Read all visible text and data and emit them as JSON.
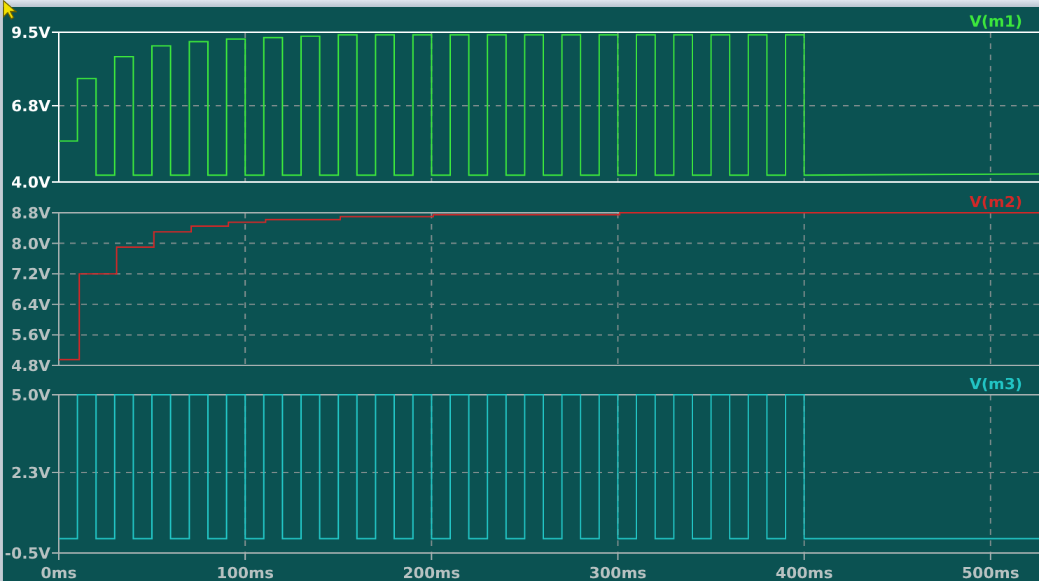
{
  "panes": [
    {
      "selected": true,
      "chart_data": {
        "type": "line",
        "grid": true,
        "xlim": [
          0,
          526
        ],
        "ylim": [
          4.0,
          9.5
        ],
        "yticks": [
          {
            "value": 4.0,
            "label": "4.0V"
          },
          {
            "value": 6.8,
            "label": "6.8V"
          },
          {
            "value": 9.5,
            "label": "9.5V"
          }
        ],
        "x": [
          0,
          10,
          10,
          20,
          20,
          30,
          30,
          40,
          40,
          50,
          50,
          60,
          60,
          70,
          70,
          80,
          80,
          90,
          90,
          100,
          100,
          110,
          110,
          120,
          120,
          130,
          130,
          140,
          140,
          150,
          150,
          160,
          160,
          170,
          170,
          180,
          180,
          190,
          190,
          200,
          200,
          210,
          210,
          220,
          220,
          230,
          230,
          240,
          240,
          250,
          250,
          260,
          260,
          270,
          270,
          280,
          280,
          290,
          290,
          300,
          300,
          310,
          310,
          320,
          320,
          330,
          330,
          340,
          340,
          350,
          350,
          360,
          360,
          370,
          370,
          380,
          380,
          390,
          390,
          400,
          400,
          526
        ],
        "series": [
          {
            "name": "V(m1)",
            "color": "#3ce63c",
            "values": [
              5.5,
              5.5,
              7.8,
              7.8,
              4.25,
              4.25,
              8.6,
              8.6,
              4.25,
              4.25,
              9.0,
              9.0,
              4.25,
              4.25,
              9.15,
              9.15,
              4.25,
              4.25,
              9.25,
              9.25,
              4.25,
              4.25,
              9.3,
              9.3,
              4.25,
              4.25,
              9.35,
              9.35,
              4.25,
              4.25,
              9.4,
              9.4,
              4.25,
              4.25,
              9.4,
              9.4,
              4.25,
              4.25,
              9.4,
              9.4,
              4.25,
              4.25,
              9.4,
              9.4,
              4.25,
              4.25,
              9.4,
              9.4,
              4.25,
              4.25,
              9.4,
              9.4,
              4.25,
              4.25,
              9.4,
              9.4,
              4.25,
              4.25,
              9.4,
              9.4,
              4.25,
              4.25,
              9.4,
              9.4,
              4.25,
              4.25,
              9.4,
              9.4,
              4.25,
              4.25,
              9.4,
              9.4,
              4.25,
              4.25,
              9.4,
              9.4,
              4.25,
              4.25,
              9.4,
              9.4,
              4.25,
              4.3
            ]
          }
        ]
      }
    },
    {
      "selected": false,
      "chart_data": {
        "type": "line",
        "grid": true,
        "xlim": [
          0,
          526
        ],
        "ylim": [
          4.8,
          8.8
        ],
        "yticks": [
          {
            "value": 4.8,
            "label": "4.8V"
          },
          {
            "value": 5.6,
            "label": "5.6V"
          },
          {
            "value": 6.4,
            "label": "6.4V"
          },
          {
            "value": 7.2,
            "label": "7.2V"
          },
          {
            "value": 8.0,
            "label": "8.0V"
          },
          {
            "value": 8.8,
            "label": "8.8V"
          }
        ],
        "x": [
          0,
          11,
          11,
          31,
          31,
          51,
          51,
          71,
          71,
          91,
          91,
          111,
          111,
          151,
          151,
          201,
          201,
          301,
          301,
          526
        ],
        "series": [
          {
            "name": "V(m2)",
            "color": "#d02828",
            "values": [
              4.95,
              4.95,
              7.2,
              7.2,
              7.9,
              7.9,
              8.3,
              8.3,
              8.45,
              8.45,
              8.55,
              8.55,
              8.62,
              8.62,
              8.7,
              8.7,
              8.75,
              8.75,
              8.8,
              8.8
            ]
          }
        ]
      }
    },
    {
      "selected": false,
      "chart_data": {
        "type": "line",
        "grid": true,
        "xlim": [
          0,
          526
        ],
        "ylim": [
          -0.5,
          5.0
        ],
        "yticks": [
          {
            "value": -0.5,
            "label": "-0.5V"
          },
          {
            "value": 2.3,
            "label": "2.3V"
          },
          {
            "value": 5.0,
            "label": "5.0V"
          }
        ],
        "xticks": [
          {
            "value": 0,
            "label": "0ms"
          },
          {
            "value": 100,
            "label": "100ms"
          },
          {
            "value": 200,
            "label": "200ms"
          },
          {
            "value": 300,
            "label": "300ms"
          },
          {
            "value": 400,
            "label": "400ms"
          },
          {
            "value": 500,
            "label": "500ms"
          }
        ],
        "x": [
          0,
          10,
          10,
          20,
          20,
          30,
          30,
          40,
          40,
          50,
          50,
          60,
          60,
          70,
          70,
          80,
          80,
          90,
          90,
          100,
          100,
          110,
          110,
          120,
          120,
          130,
          130,
          140,
          140,
          150,
          150,
          160,
          160,
          170,
          170,
          180,
          180,
          190,
          190,
          200,
          200,
          210,
          210,
          220,
          220,
          230,
          230,
          240,
          240,
          250,
          250,
          260,
          260,
          270,
          270,
          280,
          280,
          290,
          290,
          300,
          300,
          310,
          310,
          320,
          320,
          330,
          330,
          340,
          340,
          350,
          350,
          360,
          360,
          370,
          370,
          380,
          380,
          390,
          390,
          400,
          400,
          526
        ],
        "series": [
          {
            "name": "V(m3)",
            "color": "#22c4c4",
            "values": [
              0,
              0,
              5,
              5,
              0,
              0,
              5,
              5,
              0,
              0,
              5,
              5,
              0,
              0,
              5,
              5,
              0,
              0,
              5,
              5,
              0,
              0,
              5,
              5,
              0,
              0,
              5,
              5,
              0,
              0,
              5,
              5,
              0,
              0,
              5,
              5,
              0,
              0,
              5,
              5,
              0,
              0,
              5,
              5,
              0,
              0,
              5,
              5,
              0,
              0,
              5,
              5,
              0,
              0,
              5,
              5,
              0,
              0,
              5,
              5,
              0,
              0,
              5,
              5,
              0,
              0,
              5,
              5,
              0,
              0,
              5,
              5,
              0,
              0,
              5,
              5,
              0,
              0,
              5,
              5,
              0,
              0
            ]
          }
        ]
      }
    }
  ]
}
